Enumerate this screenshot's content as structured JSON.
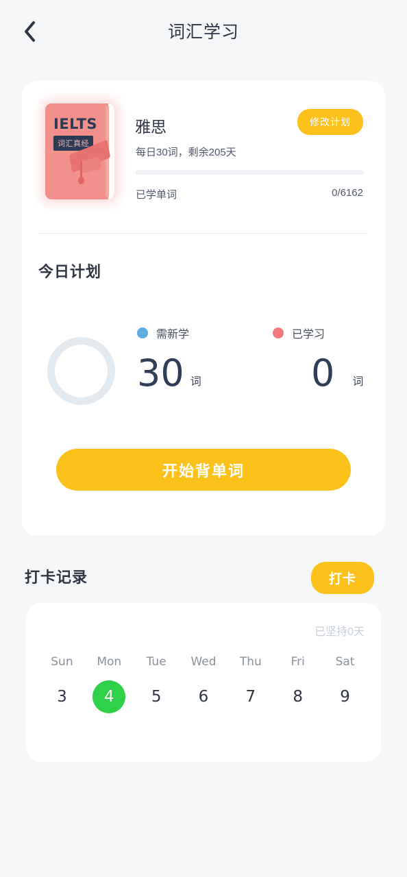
{
  "header": {
    "back_icon": "chevron-left-icon",
    "title": "词汇学习"
  },
  "book": {
    "cover_text": "IELTS",
    "cover_badge": "词汇真经",
    "title": "雅思",
    "modify_plan_label": "修改计划",
    "subtitle": "每日30词，剩余205天",
    "progress_percent": 0,
    "learned_label": "已学单词",
    "learned_count": "0/6162"
  },
  "today_plan": {
    "title": "今日计划",
    "stats": [
      {
        "label": "需新学",
        "value": "30",
        "unit": "词",
        "color": "#5cace0"
      },
      {
        "label": "已学习",
        "value": "0",
        "unit": "词",
        "color": "#f2797e"
      }
    ],
    "start_button": "开始背单词"
  },
  "checkin": {
    "title": "打卡记录",
    "button_label": "打卡",
    "streak_text": "已坚持0天",
    "days": [
      {
        "name": "Sun",
        "date": "3",
        "active": false
      },
      {
        "name": "Mon",
        "date": "4",
        "active": true
      },
      {
        "name": "Tue",
        "date": "5",
        "active": false
      },
      {
        "name": "Wed",
        "date": "6",
        "active": false
      },
      {
        "name": "Thu",
        "date": "7",
        "active": false
      },
      {
        "name": "Fri",
        "date": "8",
        "active": false
      },
      {
        "name": "Sat",
        "date": "9",
        "active": false
      }
    ]
  },
  "colors": {
    "accent_yellow": "#fcc21b",
    "active_green": "#2fd04a",
    "page_bg": "#f5f6f7",
    "card_bg": "#ffffff",
    "text_dark": "#2f3542",
    "ring_track": "#e3eaf0"
  }
}
